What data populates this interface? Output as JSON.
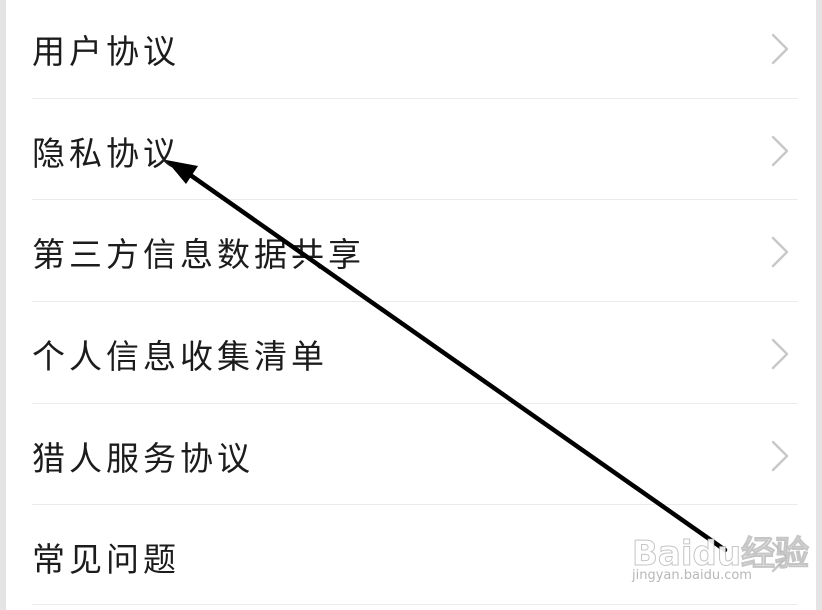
{
  "menu": {
    "items": [
      {
        "label": "用户协议"
      },
      {
        "label": "隐私协议"
      },
      {
        "label": "第三方信息数据共享"
      },
      {
        "label": "个人信息收集清单"
      },
      {
        "label": "猎人服务协议"
      },
      {
        "label": "常见问题"
      }
    ]
  },
  "annotation": {
    "arrow_color": "#000000",
    "points_to": "隐私协议"
  },
  "watermark": {
    "logo": "Baidu经验",
    "url": "jingyan.baidu.com"
  },
  "colors": {
    "text": "#1c1c1c",
    "chevron": "#c8c8c8",
    "divider": "#ebebeb",
    "background": "#ffffff"
  }
}
